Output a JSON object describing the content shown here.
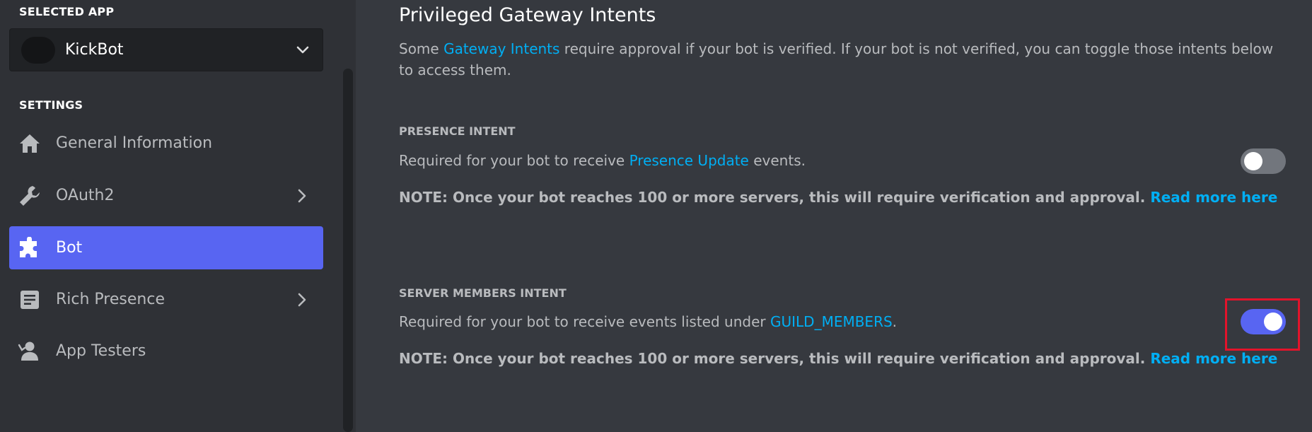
{
  "sidebar": {
    "selected_app_label": "SELECTED APP",
    "app_name": "KickBot",
    "settings_label": "SETTINGS",
    "items": [
      {
        "label": "General Information",
        "icon": "home-icon",
        "active": false,
        "has_chevron": false
      },
      {
        "label": "OAuth2",
        "icon": "wrench-icon",
        "active": false,
        "has_chevron": true
      },
      {
        "label": "Bot",
        "icon": "puzzle-icon",
        "active": true,
        "has_chevron": false
      },
      {
        "label": "Rich Presence",
        "icon": "document-icon",
        "active": false,
        "has_chevron": true
      },
      {
        "label": "App Testers",
        "icon": "person-icon",
        "active": false,
        "has_chevron": false
      }
    ]
  },
  "main": {
    "title": "Privileged Gateway Intents",
    "intro": {
      "prefix": "Some ",
      "link": "Gateway Intents",
      "suffix": " require approval if your bot is verified. If your bot is not verified, you can toggle those intents below to access them."
    },
    "intents": [
      {
        "heading": "PRESENCE INTENT",
        "desc_prefix": "Required for your bot to receive ",
        "desc_link": "Presence Update",
        "desc_suffix": " events.",
        "note": "NOTE: Once your bot reaches 100 or more servers, this will require verification and approval. ",
        "note_link": "Read more here",
        "enabled": false
      },
      {
        "heading": "SERVER MEMBERS INTENT",
        "desc_prefix": "Required for your bot to receive events listed under ",
        "desc_link": "GUILD_MEMBERS",
        "desc_suffix": ".",
        "note": "NOTE: Once your bot reaches 100 or more servers, this will require verification and approval. ",
        "note_link": "Read more here",
        "enabled": true
      }
    ]
  },
  "colors": {
    "accent": "#5865f2",
    "link": "#00aff4",
    "highlight": "#e3132b",
    "sidebar_bg": "#2f3136",
    "main_bg": "#36393f"
  }
}
